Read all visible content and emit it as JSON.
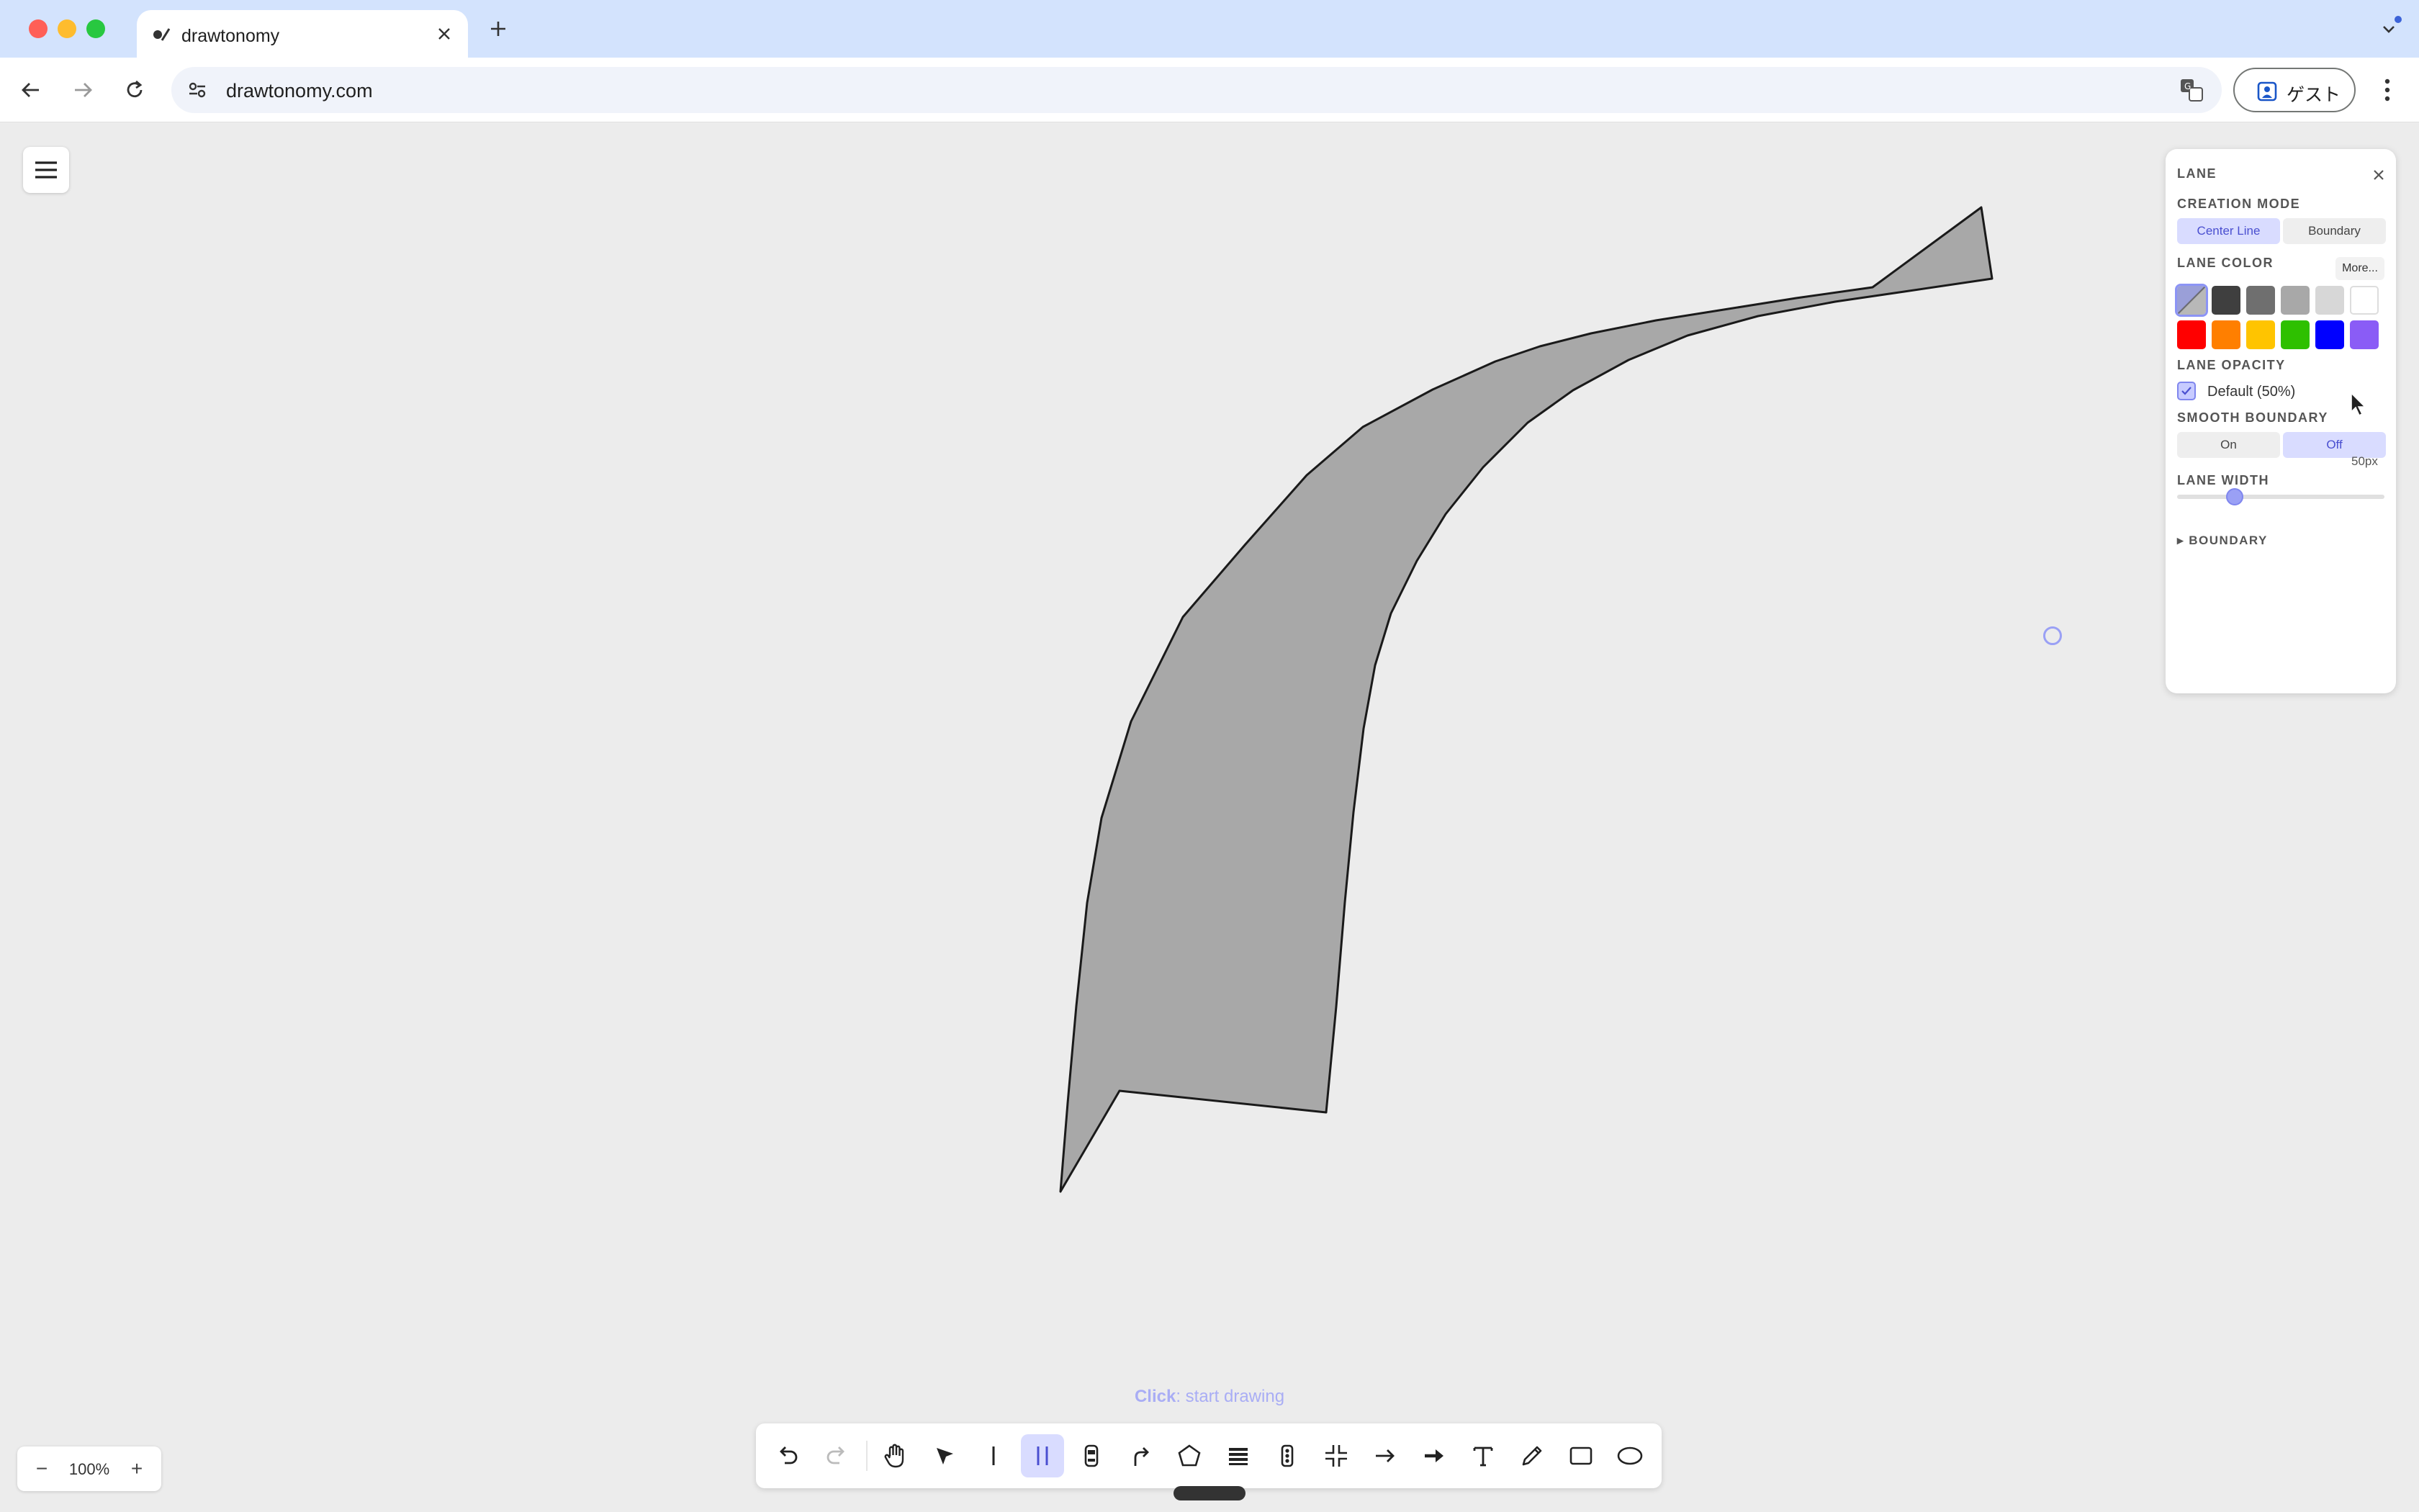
{
  "browser": {
    "tab_title": "drawtonomy",
    "url": "drawtonomy.com",
    "guest_label": "ゲスト"
  },
  "panel": {
    "title": "LANE",
    "creation_mode": {
      "heading": "CREATION MODE",
      "options": [
        "Center Line",
        "Boundary"
      ],
      "selected": "Center Line"
    },
    "lane_color": {
      "heading": "LANE COLOR",
      "more_label": "More...",
      "swatches": [
        "#8e93c9",
        "#3f3f3f",
        "#6f6f6f",
        "#a8a8a8",
        "#d7d7d7",
        "#ffffff",
        "#ff0000",
        "#ff7f00",
        "#ffc400",
        "#2ec000",
        "#0000ff",
        "#8a5cf6"
      ],
      "selected_index": 0
    },
    "lane_opacity": {
      "heading": "LANE OPACITY",
      "checkbox_label": "Default (50%)",
      "checked": true
    },
    "smooth_boundary": {
      "heading": "SMOOTH BOUNDARY",
      "options": [
        "On",
        "Off"
      ],
      "selected": "Off"
    },
    "lane_width": {
      "heading": "LANE WIDTH",
      "value_label": "50px",
      "value": 50
    },
    "boundary_section": "BOUNDARY"
  },
  "hint": {
    "action": "Click",
    "text": ": start drawing"
  },
  "zoom": {
    "minus": "−",
    "value": "100%",
    "plus": "+"
  },
  "tools": [
    {
      "name": "undo-icon",
      "active": false
    },
    {
      "name": "redo-icon",
      "active": false
    },
    {
      "name": "hand-icon",
      "active": false
    },
    {
      "name": "select-arrow-icon",
      "active": false
    },
    {
      "name": "line-icon",
      "active": false
    },
    {
      "name": "lane-icon",
      "active": true
    },
    {
      "name": "vehicle-icon",
      "active": false
    },
    {
      "name": "path-icon",
      "active": false
    },
    {
      "name": "polygon-icon",
      "active": false
    },
    {
      "name": "crosswalk-icon",
      "active": false
    },
    {
      "name": "traffic-light-icon",
      "active": false
    },
    {
      "name": "intersection-icon",
      "active": false
    },
    {
      "name": "arrow-icon",
      "active": false
    },
    {
      "name": "bold-arrow-icon",
      "active": false
    },
    {
      "name": "text-icon",
      "active": false
    },
    {
      "name": "pencil-icon",
      "active": false
    },
    {
      "name": "rectangle-icon",
      "active": false
    },
    {
      "name": "ellipse-icon",
      "active": false
    }
  ],
  "colors": {
    "accent": "#7f86ee",
    "lane_fill": "#a8a8a8",
    "canvas": "#ececec"
  }
}
